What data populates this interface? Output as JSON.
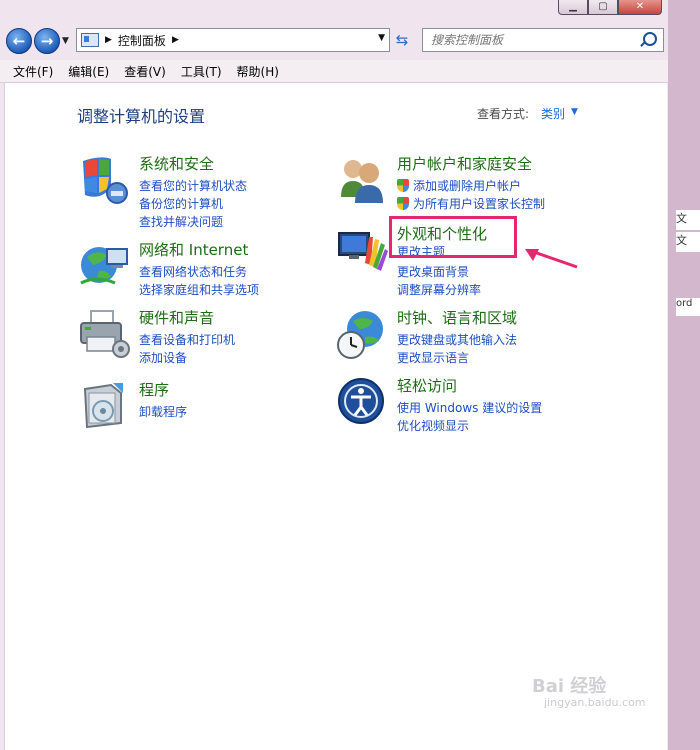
{
  "window": {
    "title_buttons": [
      "minimize",
      "maximize",
      "close"
    ]
  },
  "nav": {
    "back_icon": "back-arrow-icon",
    "forward_icon": "forward-arrow-icon",
    "address": "控制面板",
    "search_placeholder": "搜索控制面板"
  },
  "menu": [
    "文件(F)",
    "编辑(E)",
    "查看(V)",
    "工具(T)",
    "帮助(H)"
  ],
  "page": {
    "title": "调整计算机的设置",
    "view_by_label": "查看方式:",
    "view_by_value": "类别"
  },
  "categories": {
    "system": {
      "title": "系统和安全",
      "links": [
        "查看您的计算机状态",
        "备份您的计算机",
        "查找并解决问题"
      ]
    },
    "network": {
      "title": "网络和 Internet",
      "links": [
        "查看网络状态和任务",
        "选择家庭组和共享选项"
      ]
    },
    "hardware": {
      "title": "硬件和声音",
      "links": [
        "查看设备和打印机",
        "添加设备"
      ]
    },
    "programs": {
      "title": "程序",
      "links": [
        "卸载程序"
      ]
    },
    "users": {
      "title": "用户帐户和家庭安全",
      "links": [
        "添加或删除用户帐户",
        "为所有用户设置家长控制"
      ]
    },
    "appearance": {
      "title": "外观和个性化",
      "links": [
        "更改主题",
        "更改桌面背景",
        "调整屏幕分辨率"
      ]
    },
    "clock": {
      "title": "时钟、语言和区域",
      "links": [
        "更改键盘或其他输入法",
        "更改显示语言"
      ]
    },
    "access": {
      "title": "轻松访问",
      "links": [
        "使用 Windows 建议的设置",
        "优化视频显示"
      ]
    }
  },
  "side_text": [
    "文",
    "文",
    "ord"
  ],
  "watermark": {
    "main": "Bai 经验",
    "sub": "jingyan.baidu.com"
  },
  "colors": {
    "category_title": "#1c6d14",
    "link": "#1f4ec0",
    "page_title": "#1e3f80",
    "highlight": "#e6276f"
  }
}
